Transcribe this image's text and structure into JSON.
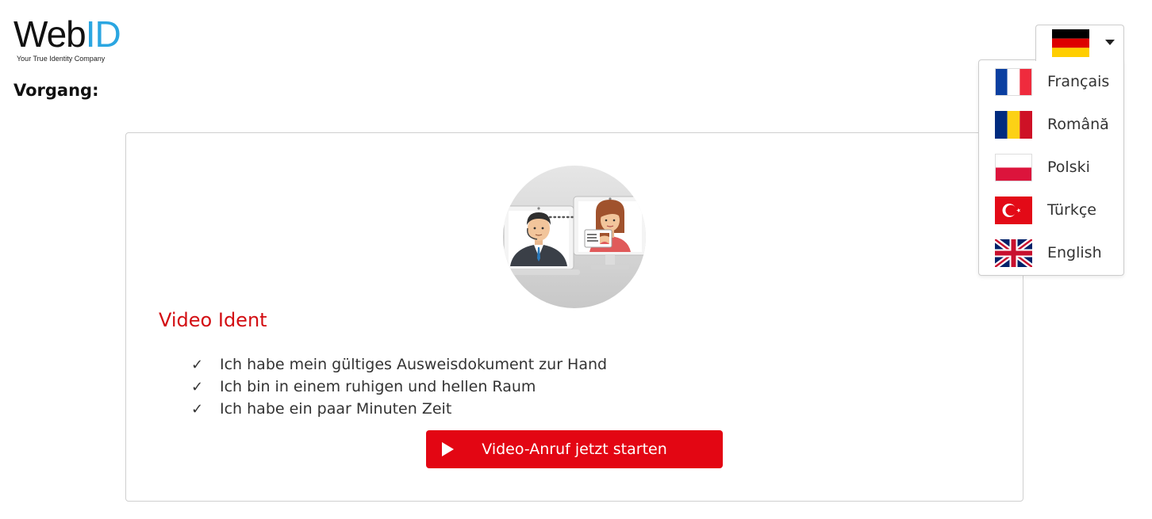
{
  "logo": {
    "brand_prefix": "Web",
    "brand_suffix": "ID",
    "tagline": "Your True Identity Company"
  },
  "process": {
    "label": "Vorgang:"
  },
  "language_selector": {
    "selected": "Deutsch",
    "selected_icon": "flag-germany-icon",
    "options": [
      {
        "label": "Français",
        "icon": "flag-france-icon"
      },
      {
        "label": "Română",
        "icon": "flag-romania-icon"
      },
      {
        "label": "Polski",
        "icon": "flag-poland-icon"
      },
      {
        "label": "Türkçe",
        "icon": "flag-turkey-icon"
      },
      {
        "label": "English",
        "icon": "flag-uk-icon"
      }
    ]
  },
  "card": {
    "illustration_icon": "video-call-illustration",
    "title": "Video Ident",
    "checklist": [
      "Ich habe mein gültiges Ausweisdokument zur Hand",
      "Ich bin in einem ruhigen und hellen Raum",
      "Ich habe ein paar Minuten Zeit"
    ],
    "check_glyph": "✓",
    "button_label": "Video-Anruf jetzt starten"
  },
  "colors": {
    "brand_blue": "#2ba6e1",
    "accent_red": "#e30613",
    "title_red": "#d30d12",
    "text": "#333333"
  }
}
